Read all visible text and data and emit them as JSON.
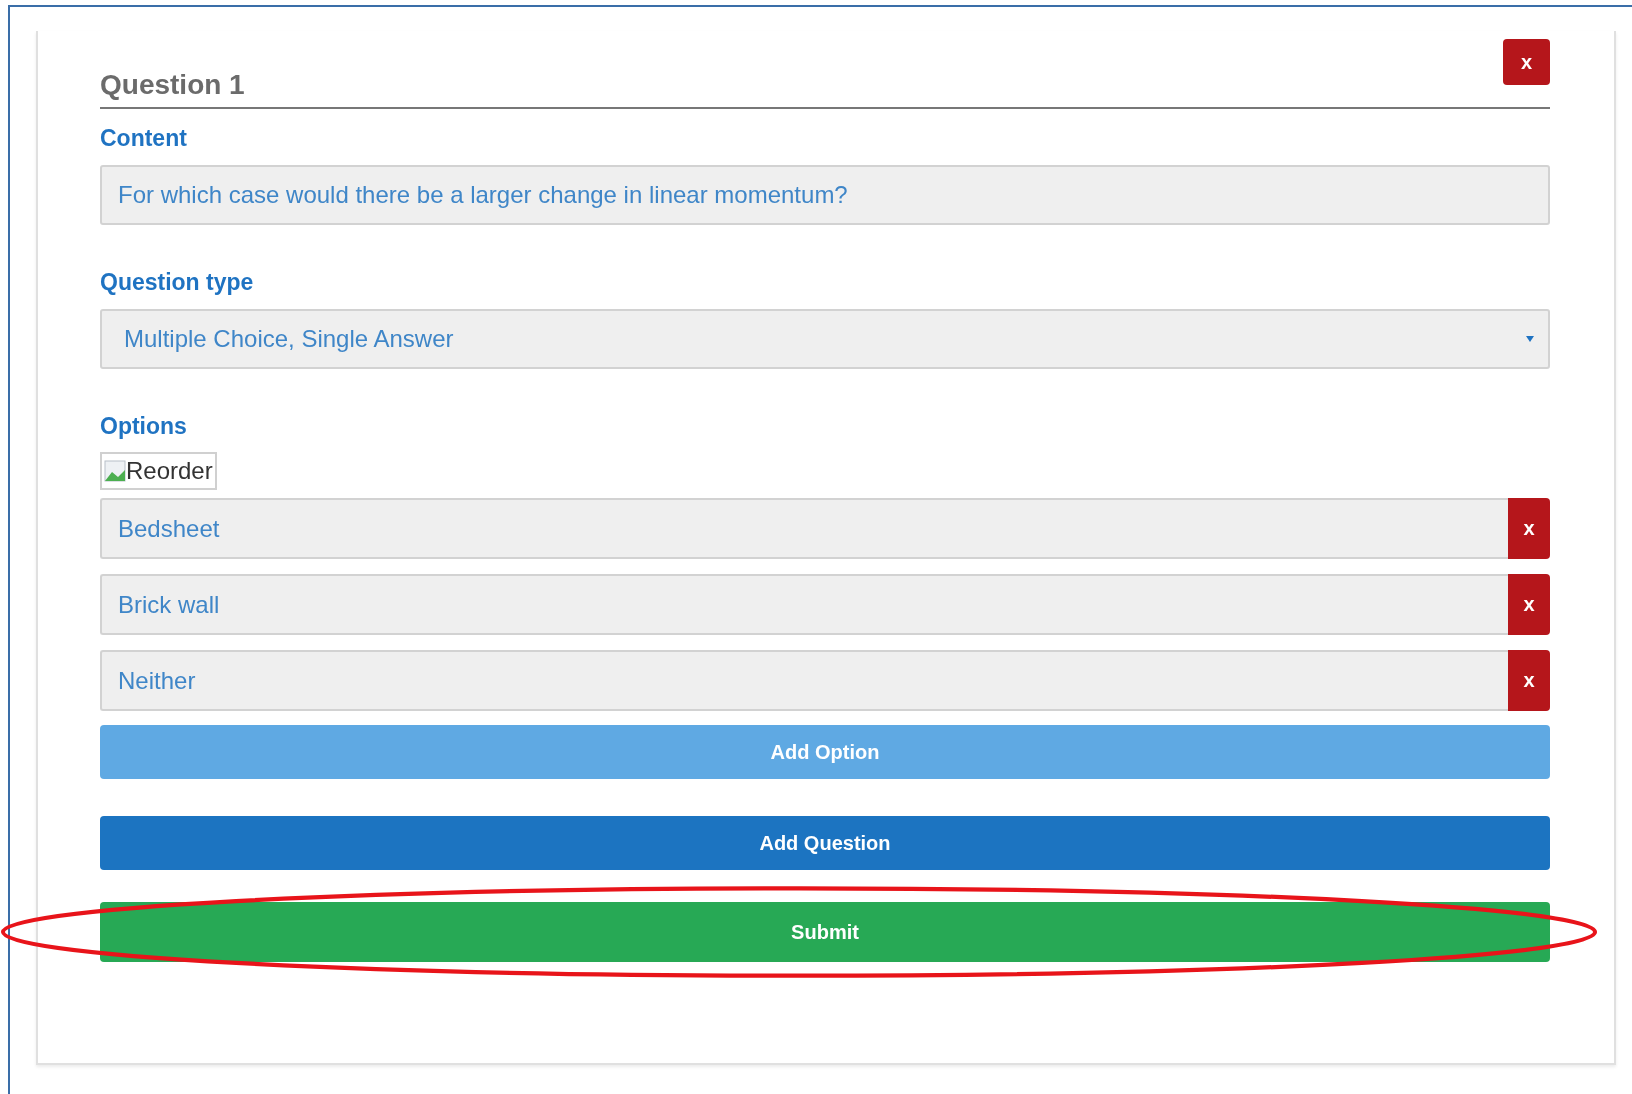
{
  "question": {
    "title": "Question 1",
    "close_label": "x"
  },
  "content": {
    "label": "Content",
    "value": "For which case would there be a larger change in linear momentum?"
  },
  "question_type": {
    "label": "Question type",
    "value": "Multiple Choice, Single Answer"
  },
  "options": {
    "label": "Options",
    "reorder_alt": "Reorder",
    "items": [
      {
        "value": "Bedsheet",
        "remove_label": "x"
      },
      {
        "value": "Brick wall",
        "remove_label": "x"
      },
      {
        "value": "Neither",
        "remove_label": "x"
      }
    ]
  },
  "add_option": "Add Option",
  "add_question": "Add Question",
  "submit": {
    "label": "Submit",
    "highlighted": true
  }
}
